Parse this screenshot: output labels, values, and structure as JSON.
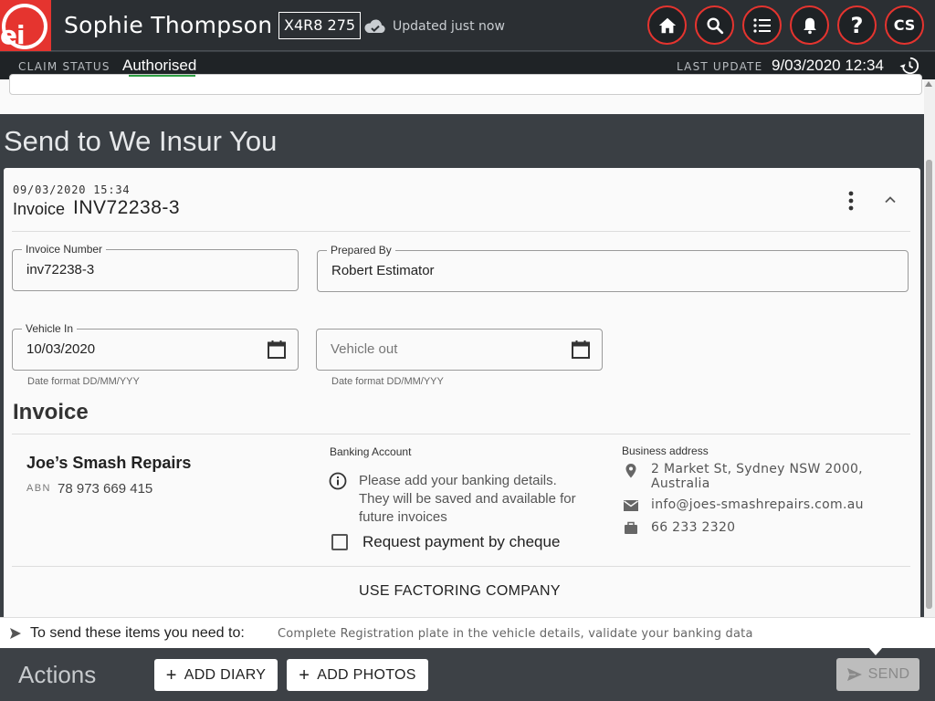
{
  "header": {
    "logo_text": "ei",
    "owner_name": "Sophie Thompson",
    "plate": "X4R8 275",
    "updated_text": "Updated just now",
    "nav": {
      "home": "home-icon",
      "search": "search-icon",
      "list": "list-icon",
      "notifications": "bell-icon",
      "help": "?",
      "user_initials": "CS"
    }
  },
  "status": {
    "claim_status_label": "CLAIM STATUS",
    "claim_status_value": "Authorised",
    "last_update_label": "LAST UPDATE",
    "last_update_value": "9/03/2020 12:34"
  },
  "section": {
    "title": "Send to We Insur You"
  },
  "card": {
    "timestamp": "09/03/2020 15:34",
    "type_label": "Invoice",
    "invoice_id": "INV72238-3",
    "fields": {
      "invoice_number": {
        "label": "Invoice Number",
        "value": "inv72238-3"
      },
      "prepared_by": {
        "label": "Prepared By",
        "value": "Robert Estimator"
      },
      "vehicle_in": {
        "label": "Vehicle In",
        "value": "10/03/2020",
        "hint": "Date format DD/MM/YYY"
      },
      "vehicle_out": {
        "placeholder": "Vehicle out",
        "hint": "Date format DD/MM/YYY"
      }
    },
    "invoice_heading": "Invoice",
    "company": {
      "name": "Joe’s Smash Repairs",
      "abn_label": "ABN",
      "abn_value": "78 973 669 415"
    },
    "banking": {
      "title": "Banking Account",
      "message": "Please add your banking details. They will be saved and available for future invoices",
      "cheque_label": "Request payment by cheque",
      "cheque_checked": false
    },
    "business": {
      "title": "Business address",
      "address_line1": "2 Market St, Sydney NSW 2000,",
      "address_line2": "Australia",
      "email": "info@joes-smashrepairs.com.au",
      "phone": "66 233 2320"
    },
    "factoring_label": "USE FACTORING COMPANY"
  },
  "requirements": {
    "title": "To send these items you need to:",
    "detail": "Complete Registration plate in the vehicle details, validate your banking data"
  },
  "actions": {
    "label": "Actions",
    "add_diary": "ADD DIARY",
    "add_photos": "ADD PHOTOS",
    "send": "SEND"
  },
  "colors": {
    "brand_red": "#e5342f",
    "header_bg": "#2b2f33",
    "status_bg": "#1f2326",
    "section_bg": "#3a3f44"
  }
}
